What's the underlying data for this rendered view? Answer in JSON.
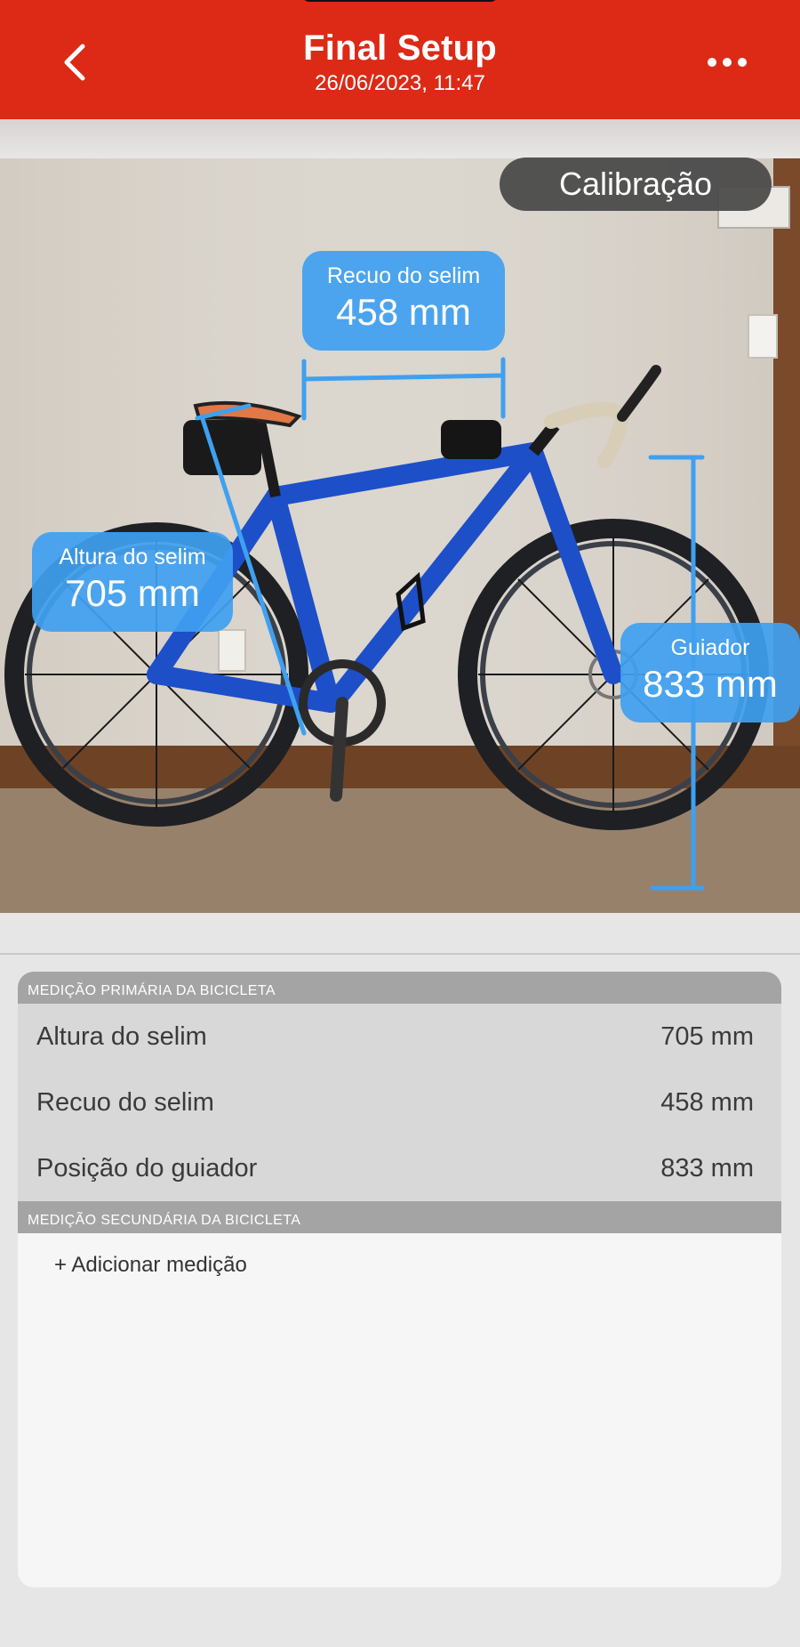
{
  "header": {
    "title": "Final Setup",
    "subtitle": "26/06/2023, 11:47",
    "back_icon": "chevron-left-icon",
    "more_icon": "ellipsis-icon",
    "color": "#dc2a16"
  },
  "photo": {
    "calibration_label": "Calibração",
    "measurements": [
      {
        "name": "Recuo do selim",
        "value": "458 mm"
      },
      {
        "name": "Altura do selim",
        "value": "705 mm"
      },
      {
        "name": "Guiador",
        "value": "833 mm"
      }
    ],
    "label_color": "#3fa0f0"
  },
  "primary_section": {
    "title": "MEDIÇÃO PRIMÁRIA DA BICICLETA",
    "rows": [
      {
        "label": "Altura do selim",
        "value": "705 mm"
      },
      {
        "label": "Recuo do selim",
        "value": "458 mm"
      },
      {
        "label": "Posição do guiador",
        "value": "833 mm"
      }
    ]
  },
  "secondary_section": {
    "title": "MEDIÇÃO SECUNDÁRIA DA BICICLETA",
    "add_label": "+ Adicionar medição"
  }
}
